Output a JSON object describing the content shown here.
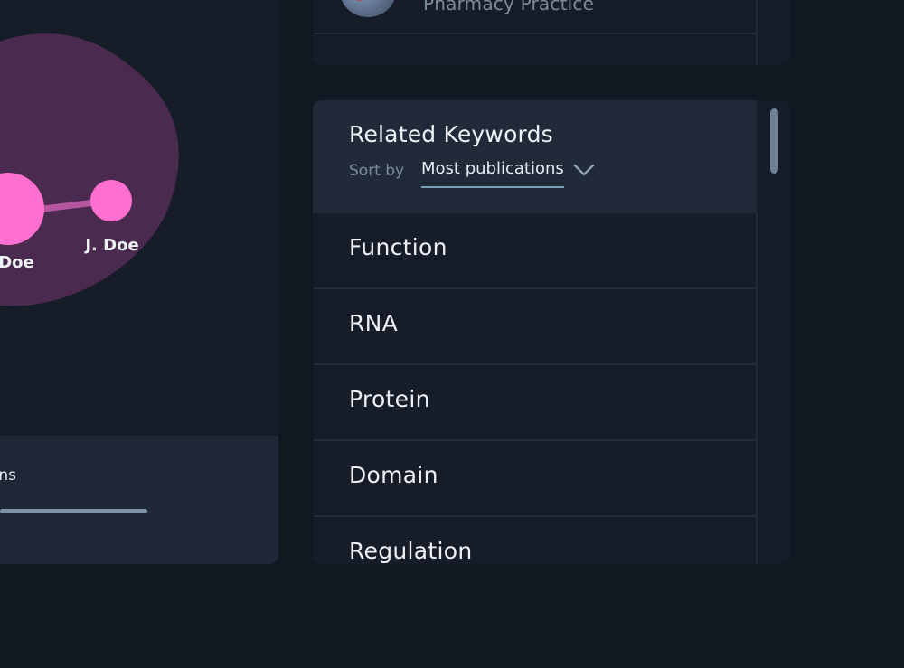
{
  "network": {
    "nodes": [
      {
        "label": "Doe"
      },
      {
        "label": "J. Doe"
      }
    ],
    "colors": {
      "cluster": "#4a2a4e",
      "node": "#ff6fd0",
      "edge": "#b557a0"
    }
  },
  "left_footer": {
    "label": "ons",
    "progress": 0.85
  },
  "top_card": {
    "department": "Pharmacy Practice"
  },
  "keywords_panel": {
    "title": "Related Keywords",
    "sort_label": "Sort by",
    "sort_value": "Most publications",
    "items": [
      {
        "label": "Function"
      },
      {
        "label": "RNA"
      },
      {
        "label": "Protein"
      },
      {
        "label": "Domain"
      },
      {
        "label": "Regulation"
      }
    ]
  },
  "colors": {
    "background": "#121821",
    "panel": "#161d29",
    "panel_header": "#202a38",
    "accent_underline": "#7aa2b7",
    "text_primary": "#eef2f7",
    "text_muted": "#7e8b9a"
  },
  "icons": {
    "sort_chevron": "chevron-down-icon"
  }
}
